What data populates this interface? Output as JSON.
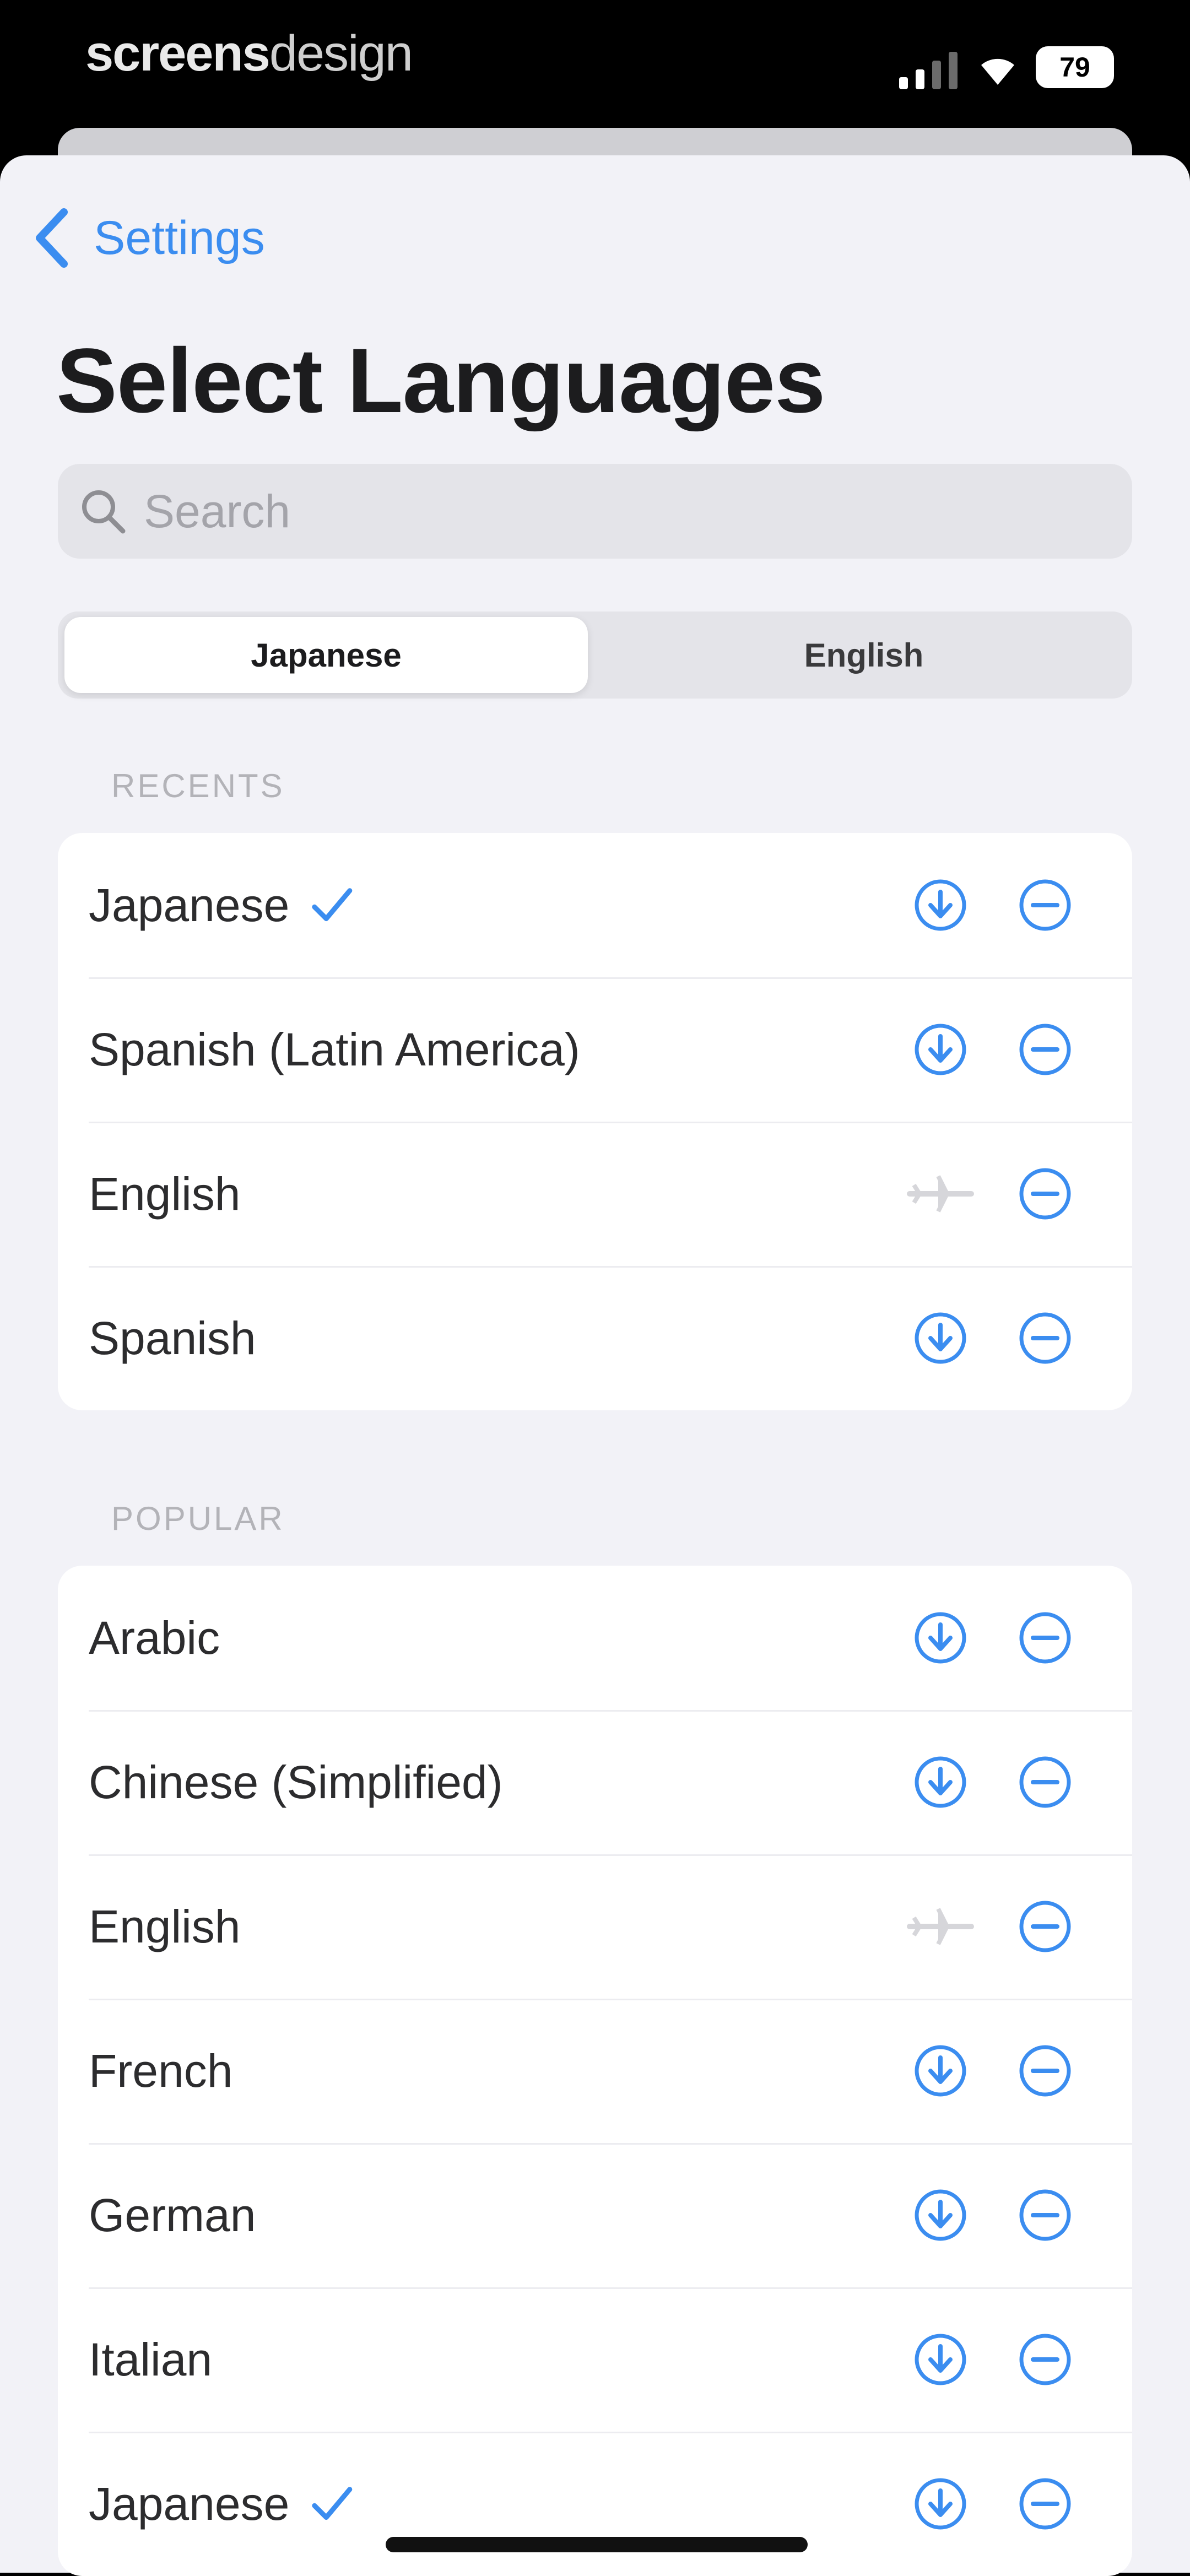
{
  "status_bar": {
    "brand_bold": "screens",
    "brand_light": "design",
    "battery": "79",
    "signal_icon": "cellular-signal-icon",
    "wifi_icon": "wifi-icon"
  },
  "nav": {
    "back_label": "Settings",
    "title": "Select Languages"
  },
  "search": {
    "placeholder": "Search"
  },
  "segmented": {
    "left": "Japanese",
    "right": "English",
    "selected": "left"
  },
  "sections": {
    "recents": {
      "header": "RECENTS",
      "items": [
        {
          "name": "Japanese",
          "checked": true,
          "state": "download"
        },
        {
          "name": "Spanish (Latin America)",
          "checked": false,
          "state": "download"
        },
        {
          "name": "English",
          "checked": false,
          "state": "offline"
        },
        {
          "name": "Spanish",
          "checked": false,
          "state": "download"
        }
      ]
    },
    "popular": {
      "header": "POPULAR",
      "items": [
        {
          "name": "Arabic",
          "checked": false,
          "state": "download"
        },
        {
          "name": "Chinese (Simplified)",
          "checked": false,
          "state": "download"
        },
        {
          "name": "English",
          "checked": false,
          "state": "offline"
        },
        {
          "name": "French",
          "checked": false,
          "state": "download"
        },
        {
          "name": "German",
          "checked": false,
          "state": "download"
        },
        {
          "name": "Italian",
          "checked": false,
          "state": "download"
        },
        {
          "name": "Japanese",
          "checked": true,
          "state": "download"
        }
      ]
    }
  },
  "colors": {
    "accent": "#3b8df0",
    "background": "#f2f2f7",
    "card": "#ffffff"
  }
}
